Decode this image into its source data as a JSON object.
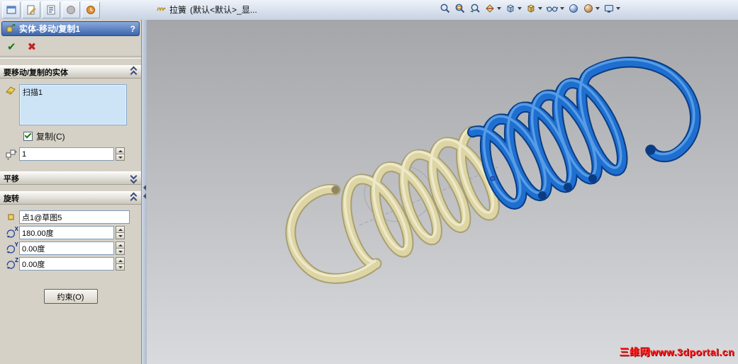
{
  "toolbar": {
    "feature_name": "拉簧",
    "configuration": "(默认<默认>_显...",
    "left_icons": [
      "window-icon",
      "document-edit-icon",
      "document-report-icon",
      "gray-sphere-icon",
      "orange-clock-icon"
    ],
    "right_icons": [
      "zoom-fit-icon",
      "zoom-area-icon",
      "previous-view-icon",
      "section-view-icon",
      "view-orientation-icon",
      "display-style-icon",
      "hide-show-items-icon",
      "edit-appearance-icon",
      "apply-scene-icon",
      "view-settings-icon"
    ]
  },
  "property_manager": {
    "title": "实体-移动/复制1",
    "help": "?",
    "ok_glyph": "✔",
    "cancel_glyph": "✖",
    "bodies_section": {
      "header": "要移动/复制的实体",
      "selected_bodies": [
        "扫描1"
      ],
      "copy_label": "复制(C)",
      "copy_checked": true,
      "copies_count": "1"
    },
    "translate_section": {
      "header": "平移",
      "collapsed": true
    },
    "rotate_section": {
      "header": "旋转",
      "origin_reference": "点1@草图5",
      "angles": [
        {
          "axis": "X",
          "value": "180.00度"
        },
        {
          "axis": "Y",
          "value": "0.00度"
        },
        {
          "axis": "Z",
          "value": "0.00度"
        }
      ]
    },
    "constraint_button": "约束(O)"
  },
  "viewport": {
    "watermark": "三维网www.3dportal.cn",
    "colors": {
      "bg_top": "#a4a6a9",
      "bg_bottom": "#d9dadd",
      "spring_yellow": "#ddd5a4",
      "spring_yellow_dark": "#a89f74",
      "spring_yellow_light": "#f3efd6",
      "spring_blue": "#1f6fd0",
      "spring_blue_dark": "#0a3c84",
      "spring_blue_light": "#6aabee",
      "construction_gray": "#97999c",
      "watermark_red": "#ff1e1e"
    }
  }
}
